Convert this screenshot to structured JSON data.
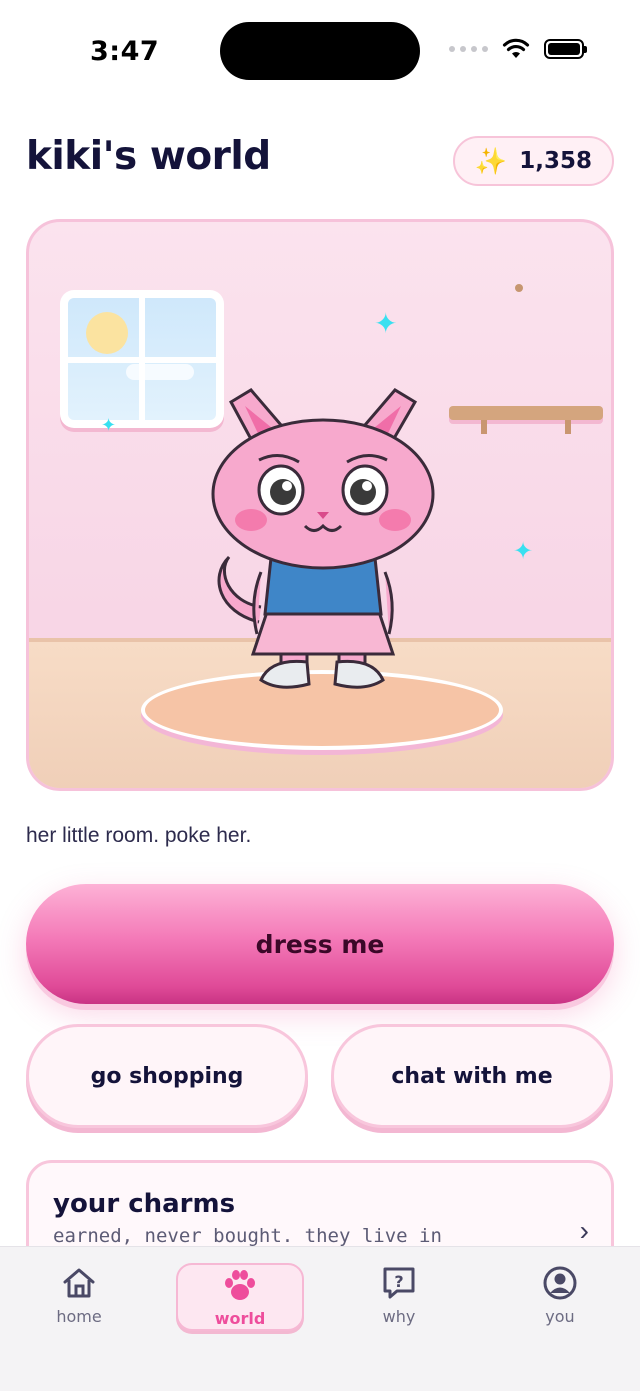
{
  "status_bar": {
    "time": "3:47"
  },
  "header": {
    "title": "kiki's world",
    "points_icon": "sparkles-icon",
    "points": "1,358"
  },
  "room": {
    "character": "pink-cat-avatar",
    "caption": "her little room. poke her."
  },
  "actions": {
    "primary_label": "dress me",
    "shopping_label": "go shopping",
    "chat_label": "chat with me"
  },
  "charms": {
    "title": "your charms",
    "subtitle": "earned, never bought. they live in"
  },
  "tabs": [
    {
      "label": "home",
      "icon": "house-icon"
    },
    {
      "label": "world",
      "icon": "paw-icon",
      "active": true
    },
    {
      "label": "why",
      "icon": "question-icon"
    },
    {
      "label": "you",
      "icon": "user-circle-icon"
    }
  ],
  "colors": {
    "accent": "#ee4d9c",
    "primary_button": "#e04b98",
    "text": "#14133a"
  }
}
